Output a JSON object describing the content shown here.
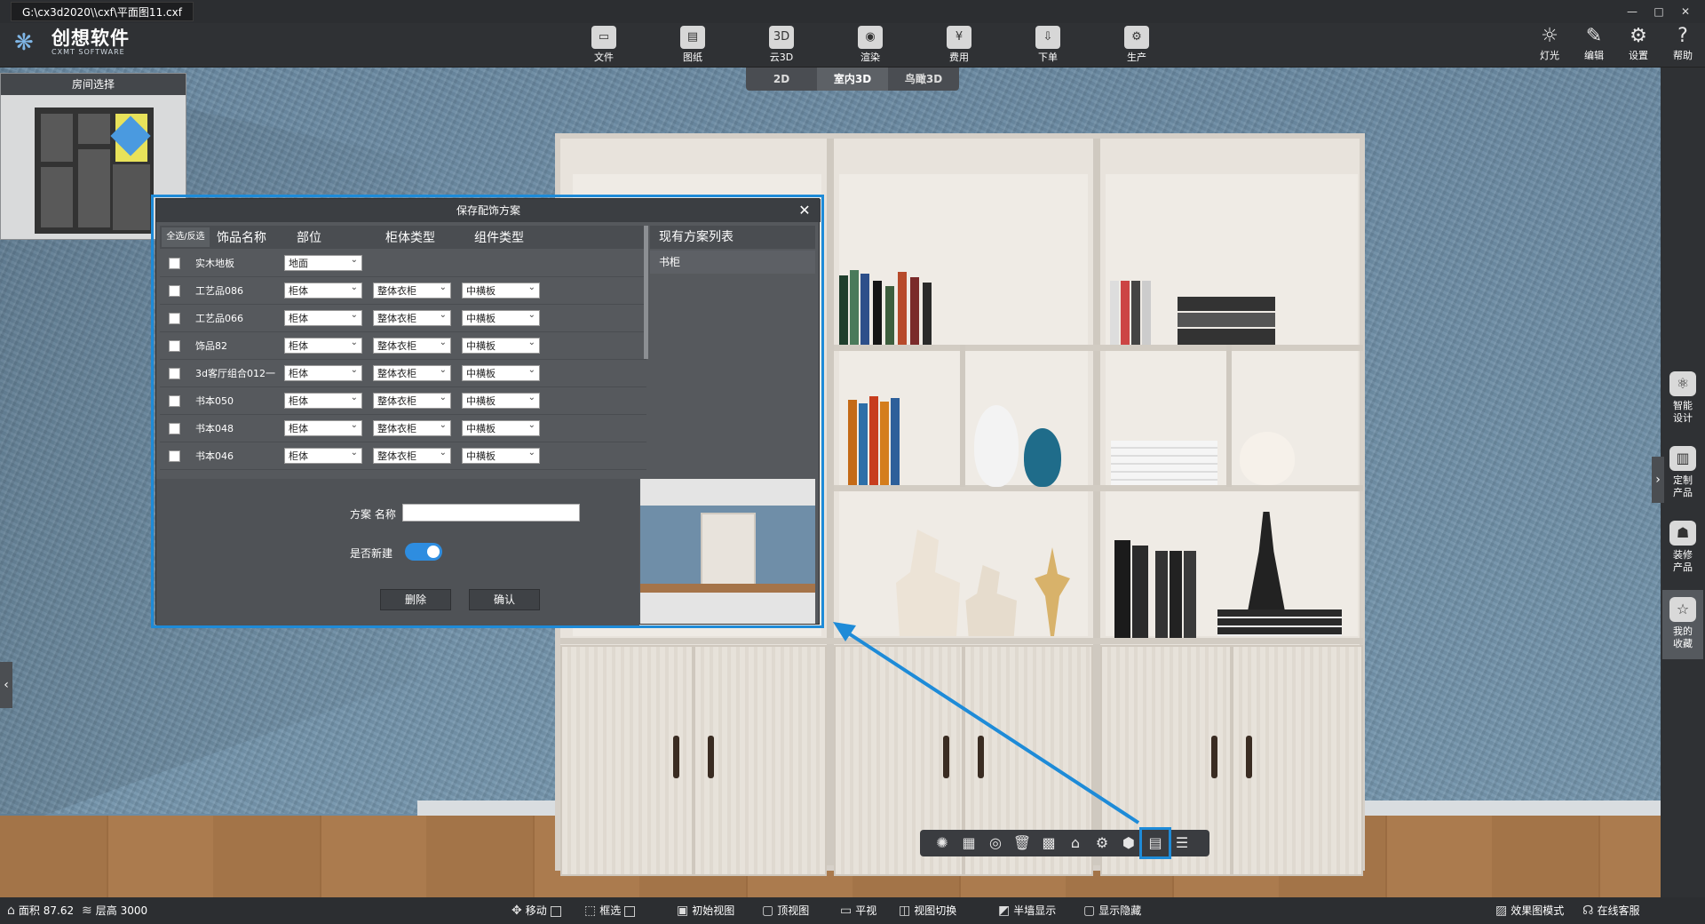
{
  "window": {
    "file_path": "G:\\cx3d2020\\\\cxf\\平面图11.cxf",
    "controls": [
      "—",
      "□",
      "✕"
    ]
  },
  "logo": {
    "cn": "创想软件",
    "en": "CXMT SOFTWARE"
  },
  "toolbar": {
    "items": [
      {
        "label": "文件",
        "icon": "file-icon",
        "glyph": "▭"
      },
      {
        "label": "图纸",
        "icon": "drawing-icon",
        "glyph": "▤"
      },
      {
        "label": "云3D",
        "icon": "cloud-3d-icon",
        "glyph": "3D"
      },
      {
        "label": "渲染",
        "icon": "camera-icon",
        "glyph": "◉"
      },
      {
        "label": "费用",
        "icon": "cost-icon",
        "glyph": "¥"
      },
      {
        "label": "下单",
        "icon": "order-icon",
        "glyph": "⇩"
      },
      {
        "label": "生产",
        "icon": "production-icon",
        "glyph": "⚙"
      }
    ],
    "right": [
      {
        "label": "灯光",
        "icon": "light-icon",
        "glyph": "☼"
      },
      {
        "label": "编辑",
        "icon": "edit-icon",
        "glyph": "✎"
      },
      {
        "label": "设置",
        "icon": "settings-icon",
        "glyph": "⚙"
      },
      {
        "label": "帮助",
        "icon": "help-icon",
        "glyph": "?"
      }
    ]
  },
  "view_tabs": [
    {
      "label": "2D",
      "active": false
    },
    {
      "label": "室内3D",
      "active": true
    },
    {
      "label": "鸟瞰3D",
      "active": false
    }
  ],
  "room_panel": {
    "title": "房间选择"
  },
  "side_panel": [
    {
      "label1": "智能",
      "label2": "设计",
      "icon": "smart-design-icon",
      "glyph": "⚛"
    },
    {
      "label1": "定制",
      "label2": "产品",
      "icon": "custom-product-icon",
      "glyph": "▥"
    },
    {
      "label1": "装修",
      "label2": "产品",
      "icon": "sofa-icon",
      "glyph": "☗"
    },
    {
      "label1": "我的",
      "label2": "收藏",
      "icon": "favorites-icon",
      "glyph": "☆"
    }
  ],
  "dialog": {
    "title": "保存配饰方案",
    "close": "✕",
    "headers": {
      "select_all": "全选/反选",
      "name": "饰品名称",
      "part": "部位",
      "cabinet_type": "柜体类型",
      "component_type": "组件类型"
    },
    "rows": [
      {
        "name": "实木地板",
        "part": "地面",
        "cabinet": "",
        "component": ""
      },
      {
        "name": "工艺品086",
        "part": "柜体",
        "cabinet": "整体衣柜",
        "component": "中横板"
      },
      {
        "name": "工艺品066",
        "part": "柜体",
        "cabinet": "整体衣柜",
        "component": "中横板"
      },
      {
        "name": "饰品82",
        "part": "柜体",
        "cabinet": "整体衣柜",
        "component": "中横板"
      },
      {
        "name": "3d客厅组合012一",
        "part": "柜体",
        "cabinet": "整体衣柜",
        "component": "中横板"
      },
      {
        "name": "书本050",
        "part": "柜体",
        "cabinet": "整体衣柜",
        "component": "中横板"
      },
      {
        "name": "书本048",
        "part": "柜体",
        "cabinet": "整体衣柜",
        "component": "中横板"
      },
      {
        "name": "书本046",
        "part": "柜体",
        "cabinet": "整体衣柜",
        "component": "中横板"
      }
    ],
    "plan_list_title": "现有方案列表",
    "plan_items": [
      "书柜"
    ],
    "form": {
      "name_label": "方案 名称",
      "name_value": "",
      "new_label": "是否新建",
      "new_enabled": true,
      "delete_label": "删除",
      "confirm_label": "确认"
    }
  },
  "float_toolbar": [
    {
      "icon": "sun-icon",
      "glyph": "✺"
    },
    {
      "icon": "grid-icon",
      "glyph": "▦"
    },
    {
      "icon": "eye-icon",
      "glyph": "◎"
    },
    {
      "icon": "trash-icon",
      "glyph": "🗑"
    },
    {
      "icon": "texture-icon",
      "glyph": "▩"
    },
    {
      "icon": "cabinet-icon",
      "glyph": "⌂"
    },
    {
      "icon": "gear-icon",
      "glyph": "⚙"
    },
    {
      "icon": "cube-icon",
      "glyph": "⬢"
    },
    {
      "icon": "save-decor-icon",
      "glyph": "▤",
      "highlight": true
    },
    {
      "icon": "list-icon",
      "glyph": "☰"
    }
  ],
  "statusbar": {
    "area_label": "面积",
    "area_value": "87.62",
    "height_label": "层高",
    "height_value": "3000",
    "move": "移动",
    "frame_select": "框选",
    "initial_view": "初始视图",
    "top_view": "顶视图",
    "flat_view": "平视",
    "switch_view": "视图切换",
    "half_wall": "半墙显示",
    "show_hide": "显示隐藏",
    "render_mode": "效果图模式",
    "online_service": "在线客服"
  }
}
